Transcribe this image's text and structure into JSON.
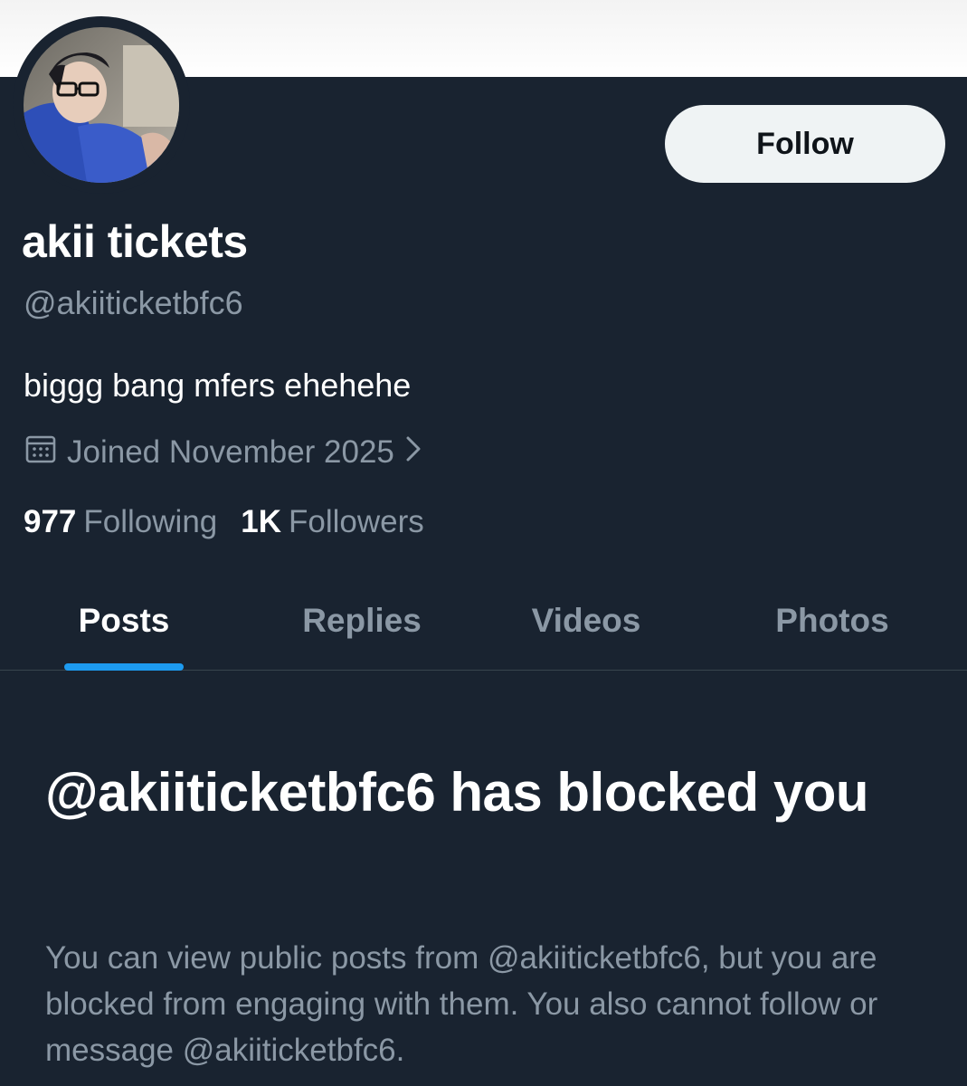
{
  "profile": {
    "display_name": "akii tickets",
    "handle": "@akiiticketbfc6",
    "bio": "biggg bang mfers ehehehe",
    "joined": "Joined November 2025",
    "following_count": "977",
    "following_label": "Following",
    "followers_count": "1K",
    "followers_label": "Followers",
    "follow_label": "Follow"
  },
  "tabs": [
    {
      "label": "Posts",
      "active": true
    },
    {
      "label": "Replies",
      "active": false
    },
    {
      "label": "Videos",
      "active": false
    },
    {
      "label": "Photos",
      "active": false
    }
  ],
  "blocked": {
    "title": "@akiiticketbfc6 has blocked you",
    "body": "You can view public posts from @akiiticketbfc6, but you are blocked from engaging with them. You also cannot follow or message @akiiticketbfc6."
  },
  "icons": {
    "calendar": "calendar-icon",
    "chevron": "chevron-right-icon"
  },
  "colors": {
    "background": "#192330",
    "accent": "#1d9bf0",
    "secondary_text": "#8b98a5",
    "follow_button": "#eff3f4"
  }
}
